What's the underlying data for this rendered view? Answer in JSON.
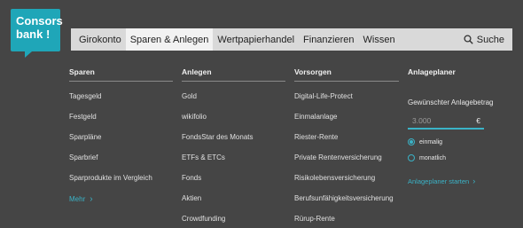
{
  "brand": {
    "line1": "Consors",
    "line2": "bank !"
  },
  "nav": {
    "items": [
      "Girokonto",
      "Sparen & Anlegen",
      "Wertpapierhandel",
      "Finanzieren",
      "Wissen"
    ],
    "active_index": 1,
    "search_label": "Suche"
  },
  "columns": [
    {
      "heading": "Sparen",
      "items": [
        "Tagesgeld",
        "Festgeld",
        "Sparpläne",
        "Sparbrief",
        "Sparprodukte im Vergleich"
      ]
    },
    {
      "heading": "Anlegen",
      "items": [
        "Gold",
        "wikifolio",
        "FondsStar des Monats",
        "ETFs & ETCs",
        "Fonds",
        "Aktien",
        "Crowdfunding"
      ]
    },
    {
      "heading": "Vorsorgen",
      "items": [
        "Digital-Life-Protect",
        "Einmalanlage",
        "Riester-Rente",
        "Private Rentenversicherung",
        "Risikolebensversicherung",
        "Berufsunfähigkeitsversicherung",
        "Rürup-Rente"
      ]
    }
  ],
  "more_label": "Mehr",
  "planner": {
    "heading": "Anlageplaner",
    "amount_label": "Gewünschter Anlagebetrag",
    "amount_placeholder": "3.000",
    "currency": "€",
    "options": [
      "einmalig",
      "monatlich"
    ],
    "selected_option": 0,
    "link_label": "Anlageplaner starten"
  },
  "colors": {
    "accent": "#3ab3c7",
    "brand": "#1fa6b8",
    "background": "#454545",
    "nav_bg": "#d9d9d9"
  }
}
